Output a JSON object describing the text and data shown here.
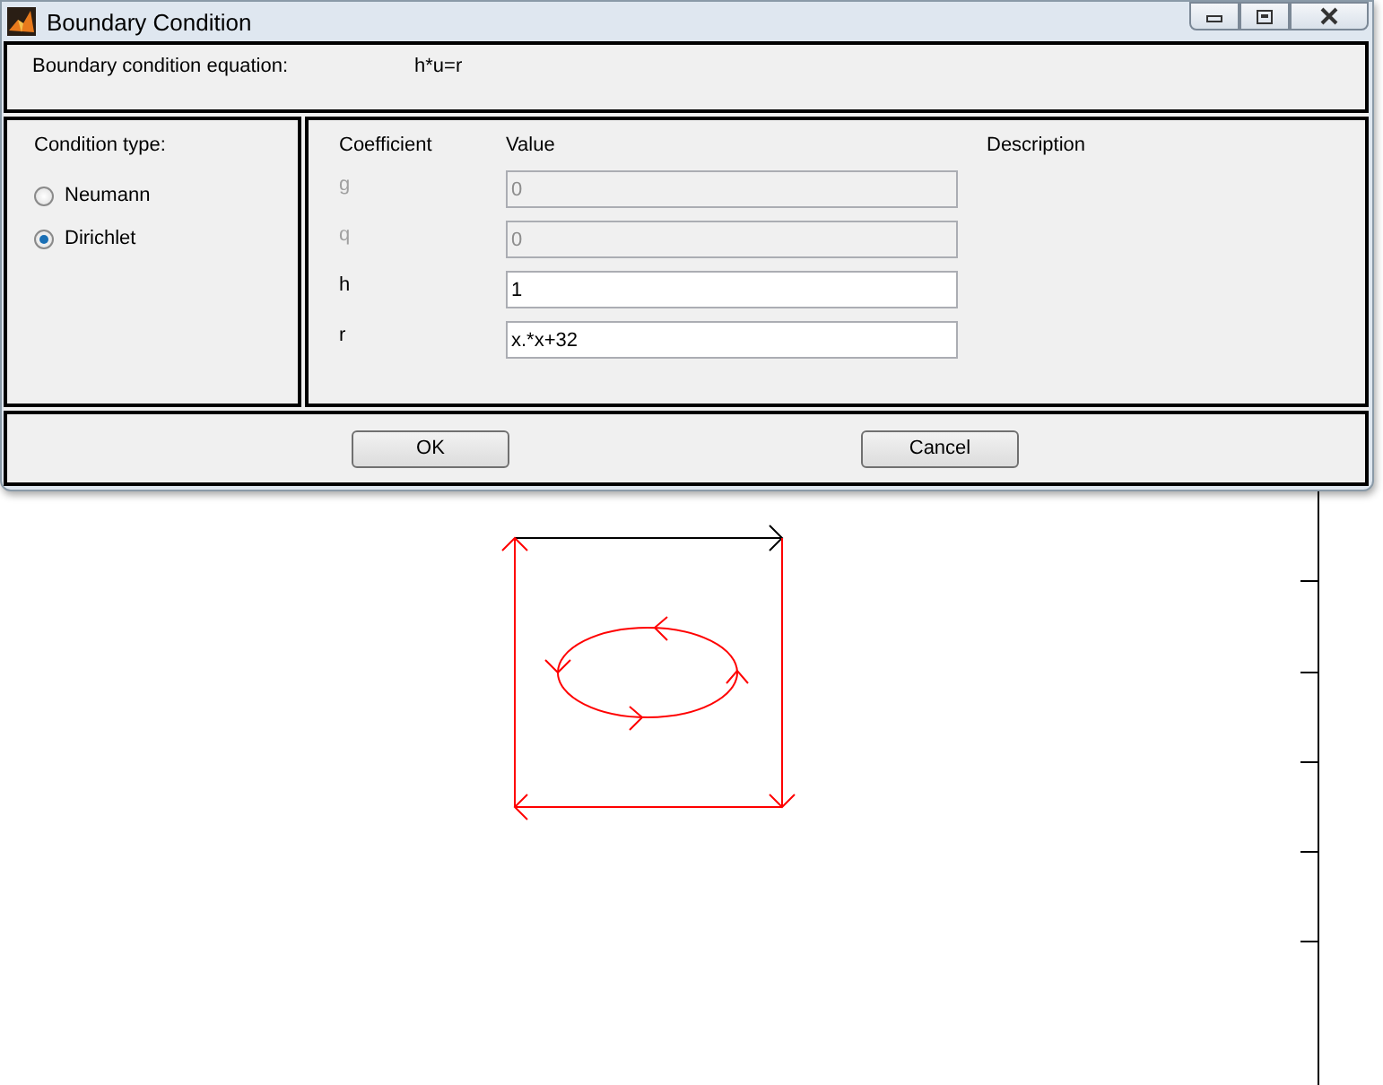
{
  "window": {
    "title": "Boundary Condition"
  },
  "equation": {
    "label": "Boundary condition equation:",
    "value": "h*u=r"
  },
  "condition_type": {
    "label": "Condition type:",
    "options": [
      {
        "label": "Neumann",
        "selected": false
      },
      {
        "label": "Dirichlet",
        "selected": true
      }
    ]
  },
  "coefficients": {
    "columns": [
      "Coefficient",
      "Value",
      "Description"
    ],
    "rows": [
      {
        "name": "g",
        "value": "0",
        "disabled": true
      },
      {
        "name": "q",
        "value": "0",
        "disabled": true
      },
      {
        "name": "h",
        "value": "1",
        "disabled": false
      },
      {
        "name": "r",
        "value": "x.*x+32",
        "disabled": false
      }
    ]
  },
  "buttons": [
    "OK",
    "Cancel"
  ]
}
